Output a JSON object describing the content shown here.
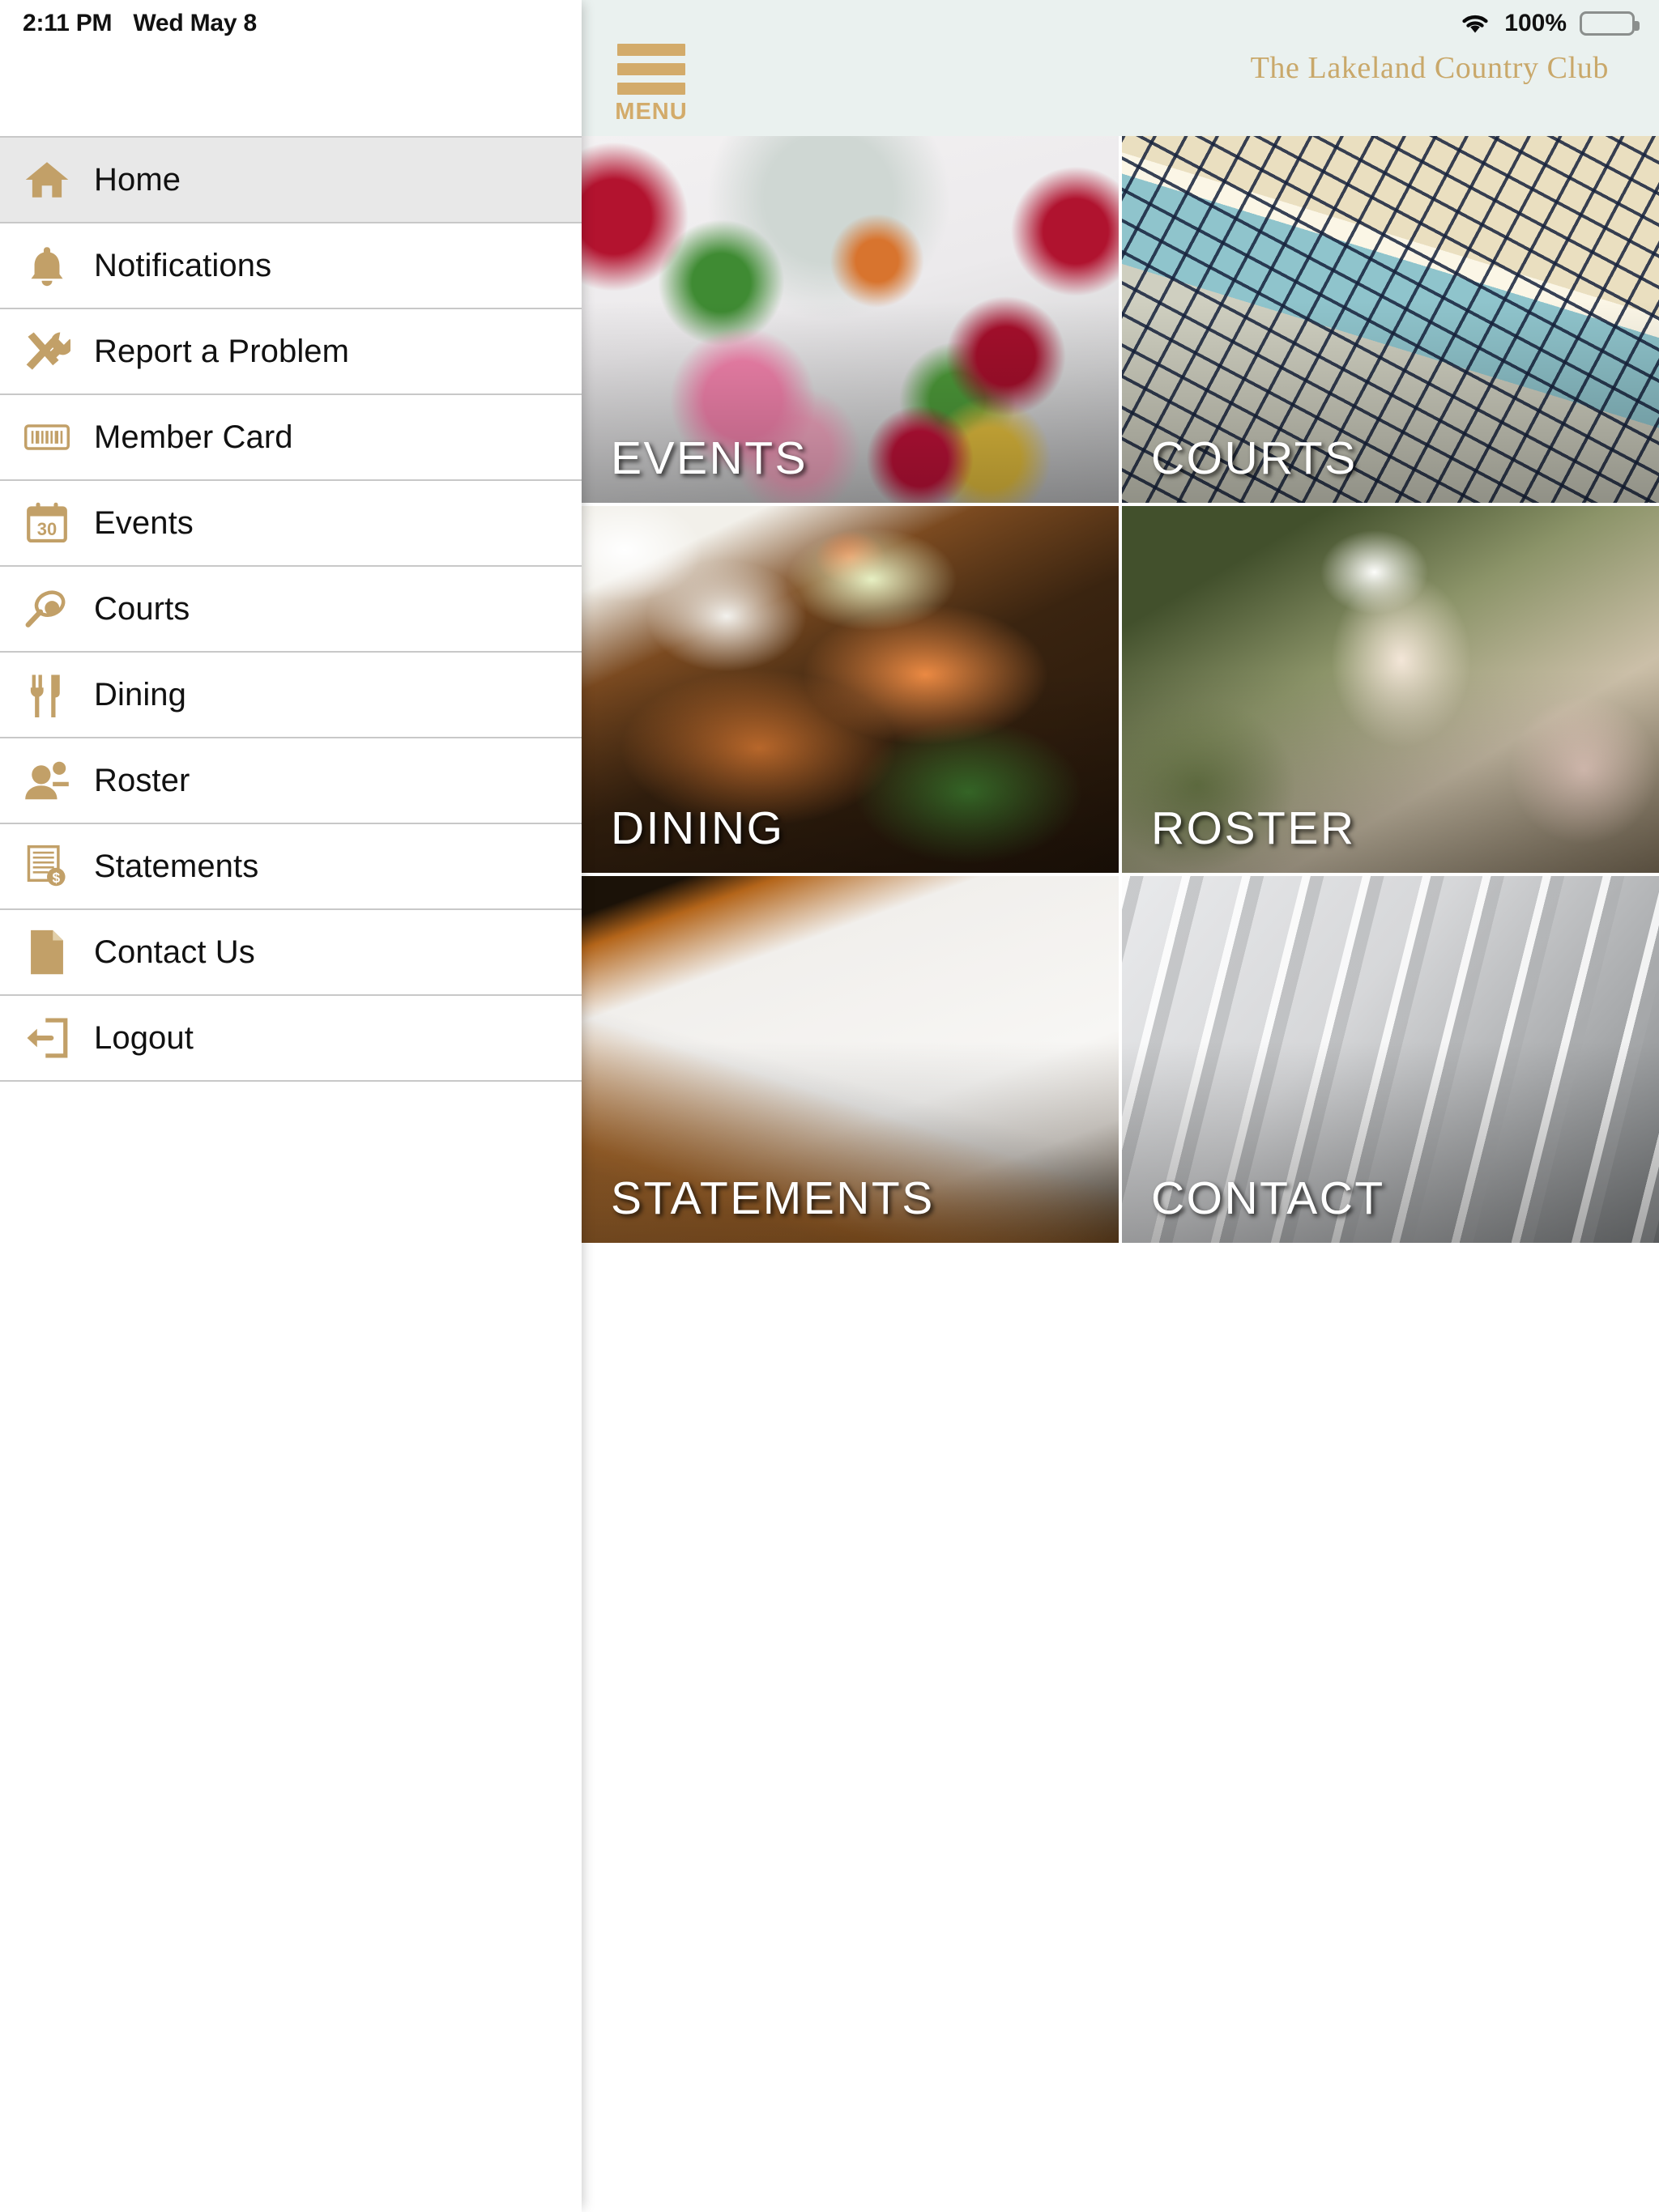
{
  "status_bar": {
    "time": "2:11 PM",
    "date": "Wed May 8",
    "wifi_icon": "wifi-icon",
    "battery_percent": "100%",
    "battery_icon": "battery-full-icon"
  },
  "sidebar": {
    "items": [
      {
        "label": "Home",
        "icon": "home-icon",
        "active": true
      },
      {
        "label": "Notifications",
        "icon": "bell-icon",
        "active": false
      },
      {
        "label": "Report a Problem",
        "icon": "tools-icon",
        "active": false
      },
      {
        "label": "Member Card",
        "icon": "barcode-icon",
        "active": false
      },
      {
        "label": "Events",
        "icon": "calendar-30-icon",
        "active": false
      },
      {
        "label": "Courts",
        "icon": "tennis-racket-icon",
        "active": false
      },
      {
        "label": "Dining",
        "icon": "fork-knife-icon",
        "active": false
      },
      {
        "label": "Roster",
        "icon": "people-icon",
        "active": false
      },
      {
        "label": "Statements",
        "icon": "invoice-dollar-icon",
        "active": false
      },
      {
        "label": "Contact Us",
        "icon": "document-icon",
        "active": false
      },
      {
        "label": "Logout",
        "icon": "logout-arrow-icon",
        "active": false
      }
    ]
  },
  "topbar": {
    "menu_button_label": "MENU",
    "menu_icon": "hamburger-icon",
    "club_title": "The Lakeland Country Club"
  },
  "tiles": [
    {
      "label": "EVENTS",
      "photo": "ph-events",
      "alt": "banquet table with flowers and wine glasses"
    },
    {
      "label": "COURTS",
      "photo": "ph-courts",
      "alt": "tennis court net close up"
    },
    {
      "label": "DINING",
      "photo": "ph-dining",
      "alt": "salmon fillet with vegetables"
    },
    {
      "label": "ROSTER",
      "photo": "ph-roster",
      "alt": "person wearing a white cap outdoors"
    },
    {
      "label": "STATEMENTS",
      "photo": "ph-statements",
      "alt": "printed billing statement pages"
    },
    {
      "label": "CONTACT",
      "photo": "ph-contact",
      "alt": "white paper sheets close up"
    }
  ],
  "colors": {
    "accent_gold": "#c9a86a",
    "icon_gold": "#c2a068",
    "topbar_background": "#eaf1ef",
    "active_row": "#e8e8e8",
    "divider": "#c8c8c8"
  }
}
